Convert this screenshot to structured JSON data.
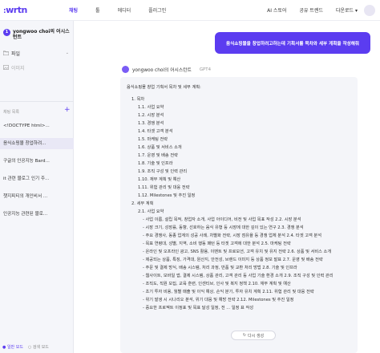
{
  "brand": {
    "logo": "wrtn"
  },
  "nav": {
    "left": [
      "채팅",
      "툴",
      "에디터",
      "플러그인"
    ],
    "right": [
      "AI 스토어",
      "공유 트렌드",
      "다운로드 ▾"
    ]
  },
  "sidebar": {
    "workspace_badge": "1",
    "workspace_name": "yongwoo choi의 어시스턴트",
    "items": [
      {
        "icon": "folder-icon",
        "label": "파일"
      },
      {
        "icon": "image-icon",
        "label": "이미지"
      }
    ],
    "section_label": "채팅 목록",
    "history": [
      "<!DOCTYPE html>...",
      "음식쇼핑몰 창업하려...",
      "구글의 인공지능 Bard...",
      "it 관련 블로그 인기 주...",
      "챗지피티의 개인비서 ...",
      "인공지능 관련된 블로..."
    ],
    "mode_primary": "일반 모드",
    "mode_secondary": "검색 모드"
  },
  "chat": {
    "user_message": "음식쇼핑몰을 창업하려고하는데 기획서를 목차와 세부 계획을 작성해줘",
    "bot_name": "yongwoo choi의 어시스턴트",
    "bot_model": "GPT4",
    "lines": [
      {
        "lvl": 0,
        "text": "음식쇼핑몰 창업 기획서 목차 및 세부 계획:"
      },
      {
        "lvl": 1,
        "text": "1. 목차"
      },
      {
        "lvl": 2,
        "text": "1.1. 사업 요약"
      },
      {
        "lvl": 2,
        "text": "1.2. 시장 분석"
      },
      {
        "lvl": 2,
        "text": "1.3. 경쟁 분석"
      },
      {
        "lvl": 2,
        "text": "1.4. 타겟 고객 분석"
      },
      {
        "lvl": 2,
        "text": "1.5. 마케팅 전략"
      },
      {
        "lvl": 2,
        "text": "1.6. 상품 및 서비스 소개"
      },
      {
        "lvl": 2,
        "text": "1.7. 운영 및 배송 전략"
      },
      {
        "lvl": 2,
        "text": "1.8. 기술 및 인프라"
      },
      {
        "lvl": 2,
        "text": "1.9. 조직 구성 및 인력 관리"
      },
      {
        "lvl": 2,
        "text": "1.10. 재무 계획 및 예산"
      },
      {
        "lvl": 2,
        "text": "1.11. 위험 관리 및 대응 전략"
      },
      {
        "lvl": 2,
        "text": "1.12. Milestones 및 추진 일정"
      },
      {
        "lvl": 1,
        "text": "2. 세부 계획"
      },
      {
        "lvl": 2,
        "text": "2.1. 사업 요약"
      },
      {
        "lvl": 3,
        "text": "- 사업 이름, 설립 목적, 창업자 소개, 사업 아이디어, 비전 및 사업 목표 작성 2.2. 시장 분석"
      },
      {
        "lvl": 3,
        "text": "- 시장 크기, 성장률, 동향, 선호하는 음식 유형 등 시장에 대한 깊이 있는 연구 2.3. 경쟁 분석"
      },
      {
        "lvl": 3,
        "text": "- 주요 경쟁사, 동종 업계의 성공 사례, 차별화 전략, 시장 점유율 등 경쟁 업체 분석 2.4. 타겟 고객 분석"
      },
      {
        "lvl": 3,
        "text": "- 목표 연령대, 성별, 지역, 소비 행동 패턴 등 타겟 고객에 대한 분석 2.5. 마케팅 전략"
      },
      {
        "lvl": 3,
        "text": "- 온라인 및 오프라인 광고, SNS 활용, 이벤트 및 프로모션, 고객 유치 및 유지 전략 2.6. 상품 및 서비스 소개"
      },
      {
        "lvl": 3,
        "text": "- 제공되는 상품, 특징, 가격대, 원산지, 안전성, 브랜드 이미지 등 상품 정보 발표 2.7. 운영 및 배송 전략"
      },
      {
        "lvl": 3,
        "text": "- 주문 및 결제 방식, 배송 시스템, 처리 과정, 반품 및 교환 처리 방법 2.8. 기술 및 인프라"
      },
      {
        "lvl": 3,
        "text": "- 웹사이트, 모바일 앱, 결제 시스템, 상품 관리, 고객 관리 등 사업 기술 환경 소개 2.9. 조직 구성 및 인력 관리"
      },
      {
        "lvl": 3,
        "text": "- 조직도, 직원 모집, 교육 훈련, 인센티브, 인사 및 복지 정책 2.10. 재무 계획 및 예산"
      },
      {
        "lvl": 3,
        "text": "- 초기 투자 비용, 월별 매출 및 이익 예상, 손익 분기, 투자 유치 계획 2.11. 위험 관리 및 대응 전략"
      },
      {
        "lvl": 3,
        "text": "- 위기 발생 시 시나리오 분석, 위기 대응 및 예방 전략 2.12. Milestones 및 추진 일정"
      },
      {
        "lvl": 3,
        "text": "- 중요한 프로젝트 이정표 및 목표 달성 일정, 전 ... 일정 표 작성"
      }
    ],
    "stop_label": "다시 생성"
  }
}
